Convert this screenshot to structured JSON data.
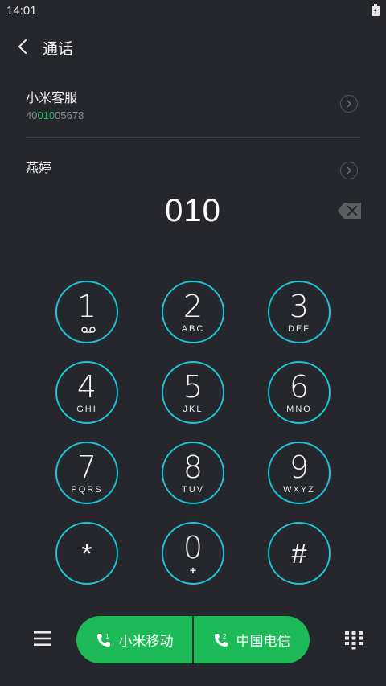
{
  "status_bar": {
    "time": "14:01"
  },
  "header": {
    "title": "通话"
  },
  "contacts": [
    {
      "name": "小米客服",
      "number_prefix": "40",
      "number_match": "010",
      "number_suffix": "05678"
    },
    {
      "name": "燕婷"
    }
  ],
  "dialed_number": "010",
  "keys": [
    {
      "digit": "1",
      "letters": ""
    },
    {
      "digit": "2",
      "letters": "ABC"
    },
    {
      "digit": "3",
      "letters": "DEF"
    },
    {
      "digit": "4",
      "letters": "GHI"
    },
    {
      "digit": "5",
      "letters": "JKL"
    },
    {
      "digit": "6",
      "letters": "MNO"
    },
    {
      "digit": "7",
      "letters": "PQRS"
    },
    {
      "digit": "8",
      "letters": "TUV"
    },
    {
      "digit": "9",
      "letters": "WXYZ"
    },
    {
      "digit": "*",
      "letters": ""
    },
    {
      "digit": "0",
      "letters": "+"
    },
    {
      "digit": "#",
      "letters": ""
    }
  ],
  "call_buttons": {
    "sim1": {
      "label": "小米移动",
      "sim_number": "1"
    },
    "sim2": {
      "label": "中国电信",
      "sim_number": "2"
    }
  },
  "colors": {
    "background": "#25272c",
    "key_ring": "#19c6d6",
    "call_green": "#1dbb57",
    "match_highlight": "#1fbe5a"
  }
}
